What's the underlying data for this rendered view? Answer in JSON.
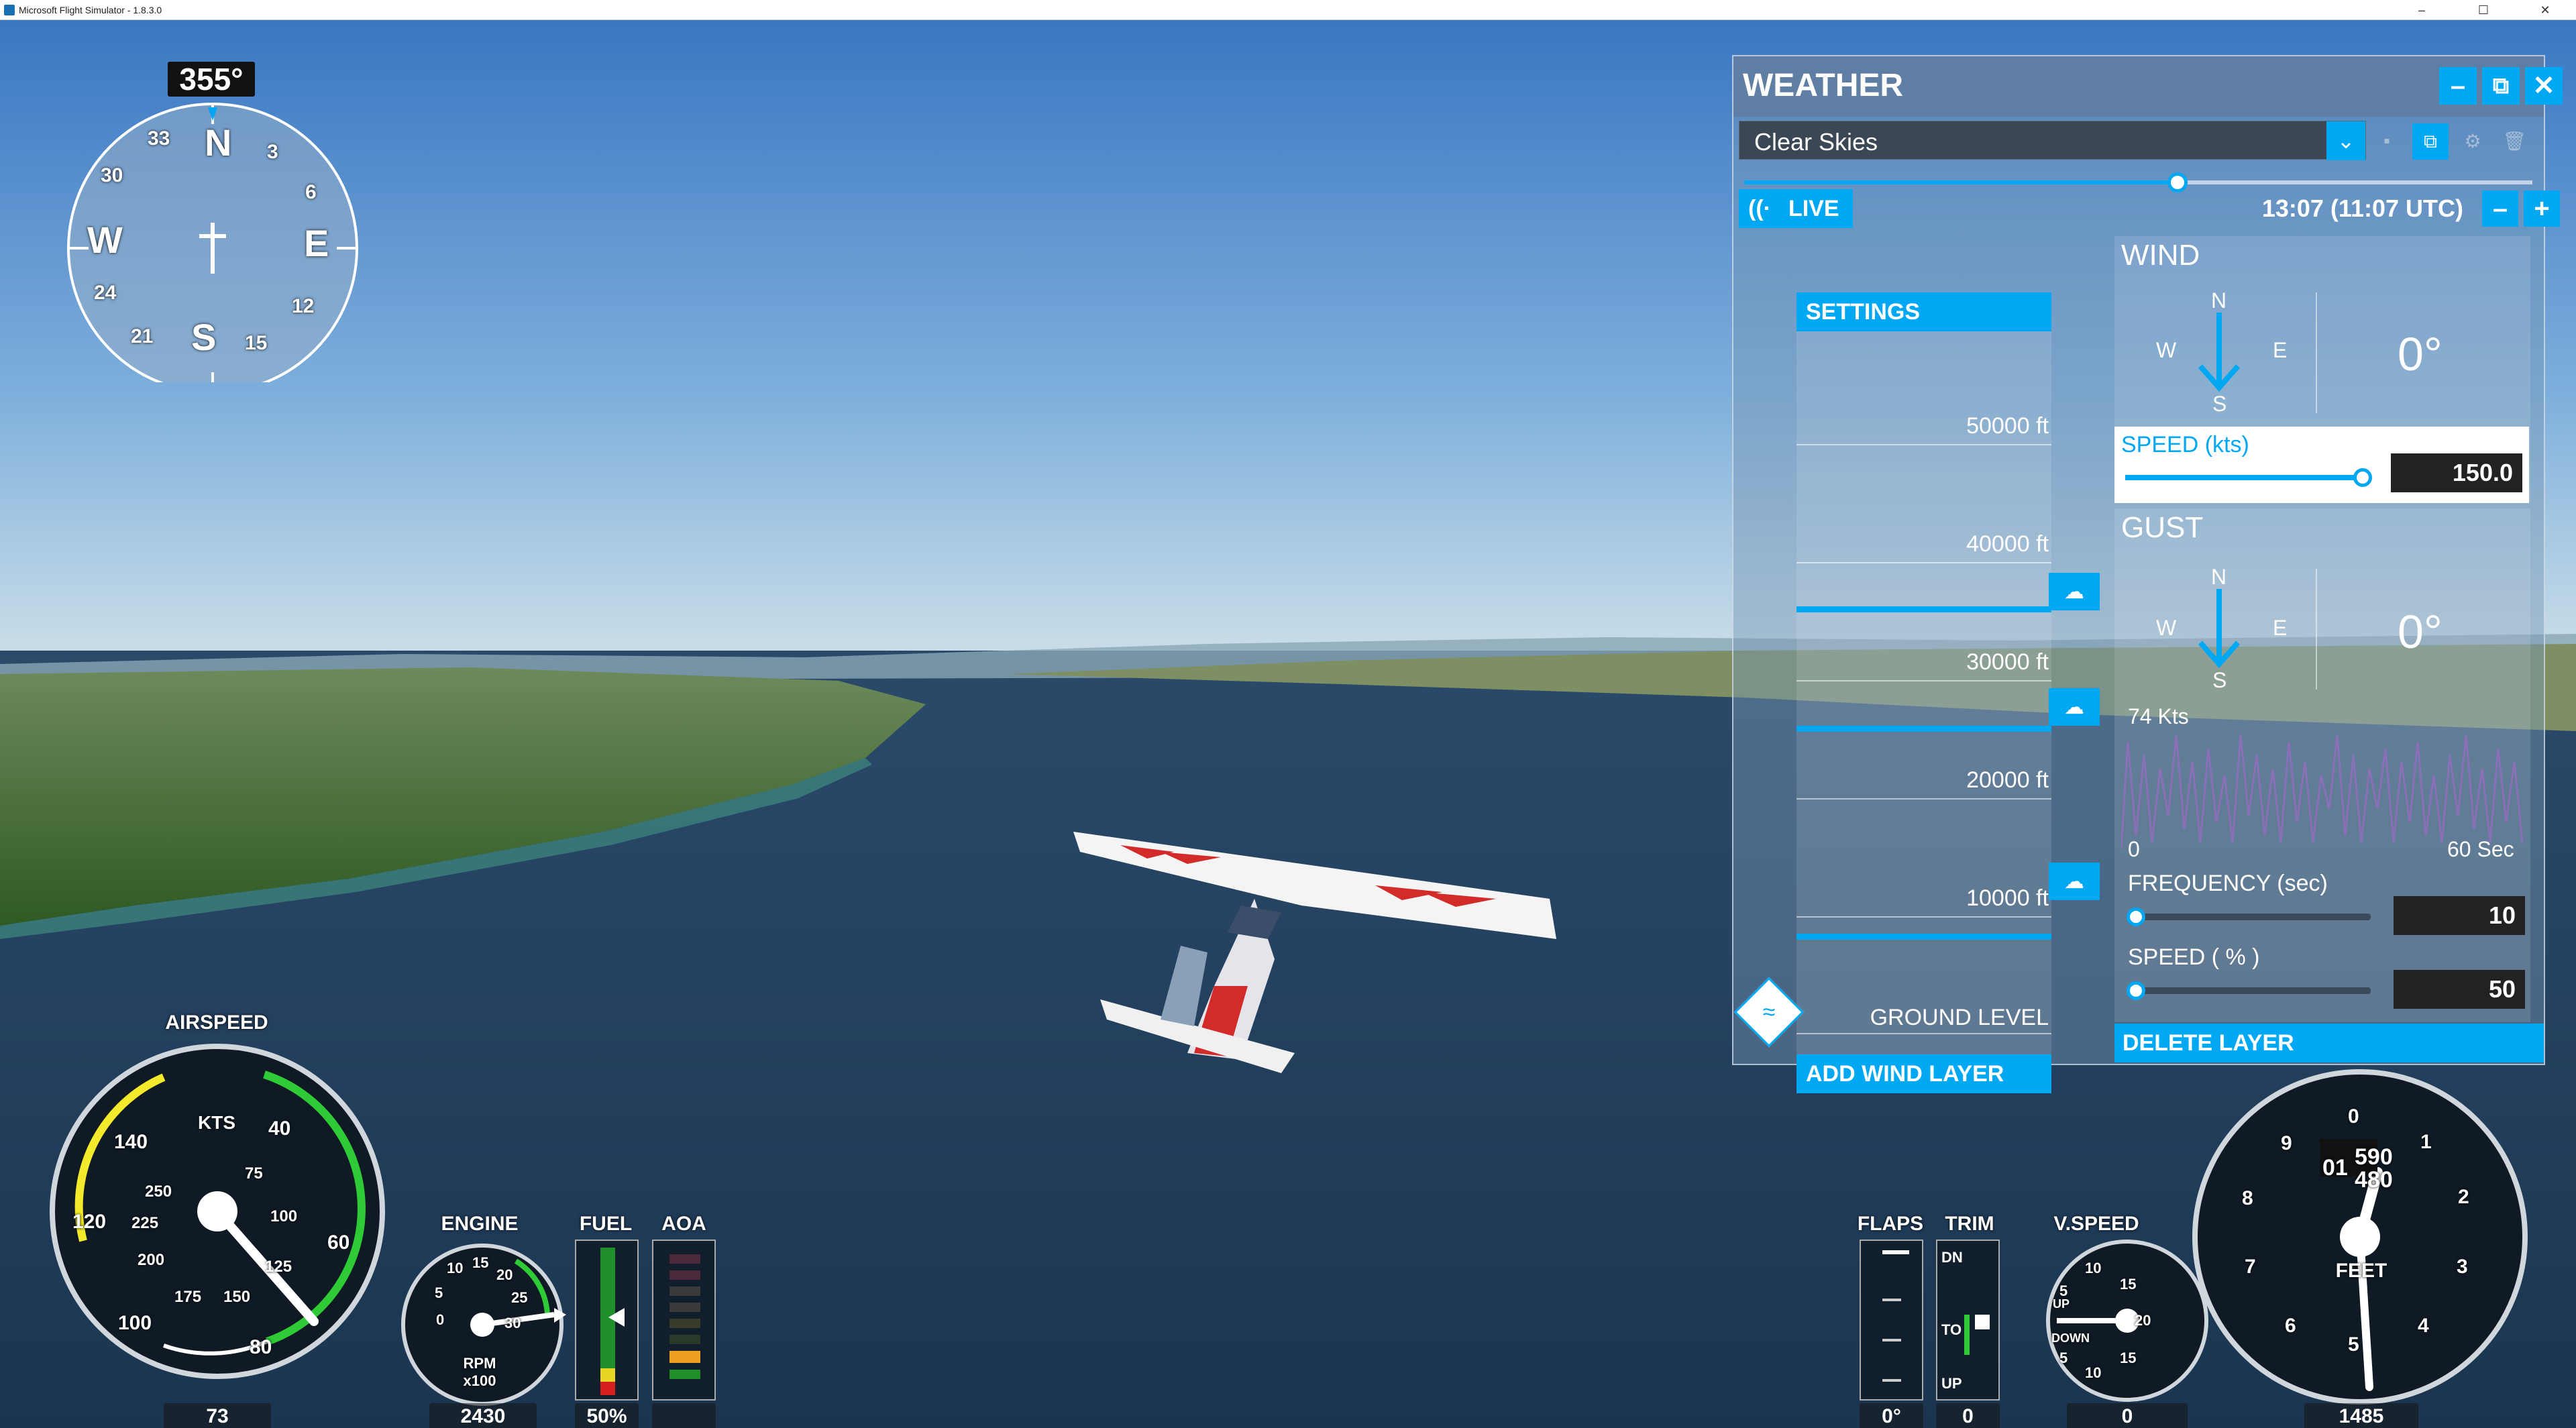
{
  "window": {
    "title": "Microsoft Flight Simulator - 1.8.3.0",
    "controls": [
      "–",
      "☐",
      "✕"
    ]
  },
  "hud": {
    "heading": "355°",
    "compass_letters": {
      "n": "N",
      "e": "E",
      "s": "S",
      "w": "W"
    },
    "compass_numbers": [
      "3",
      "6",
      "12",
      "15",
      "21",
      "24",
      "30",
      "33"
    ],
    "airspeed": {
      "label": "AIRSPEED",
      "units": "KTS",
      "value": "73",
      "ticks": [
        "40",
        "60",
        "80",
        "100",
        "120",
        "140",
        "75",
        "100",
        "125",
        "150",
        "175",
        "200",
        "225",
        "250"
      ]
    },
    "engine": {
      "label": "ENGINE",
      "units": "RPM x100",
      "value": "2430",
      "ticks": [
        "0",
        "5",
        "10",
        "15",
        "20",
        "25",
        "30"
      ]
    },
    "fuel": {
      "label": "FUEL",
      "value": "50%"
    },
    "aoa": {
      "label": "AOA",
      "value": ""
    },
    "flaps": {
      "label": "FLAPS",
      "value": "0°"
    },
    "trim": {
      "label": "TRIM",
      "value": "0",
      "marks": [
        "DN",
        "TO",
        "UP"
      ]
    },
    "vspeed": {
      "label": "V.SPEED",
      "value": "0",
      "ticks": [
        "5",
        "10",
        "15",
        "20",
        "15",
        "10",
        "5"
      ],
      "up": "UP",
      "down": "DOWN"
    },
    "altimeter": {
      "value": "1485",
      "units": "FEET",
      "digits_main": "01",
      "digits_roll_top": "590",
      "digits_roll_bot": "480",
      "ticks": [
        "0",
        "1",
        "2",
        "3",
        "4",
        "5",
        "6",
        "7",
        "8",
        "9"
      ]
    }
  },
  "weather": {
    "title": "WEATHER",
    "header_buttons": [
      "–",
      "⧉",
      "✕"
    ],
    "preset": "Clear Skies",
    "time": {
      "text": "13:07 (11:07 UTC)",
      "live_label": "LIVE",
      "slider_fraction": 0.55
    },
    "altitude_column": {
      "settings_tab": "SETTINGS",
      "labels": [
        "50000 ft",
        "40000 ft",
        "30000 ft",
        "20000 ft",
        "10000 ft",
        "GROUND LEVEL"
      ],
      "add_wind_layer": "ADD WIND LAYER"
    },
    "wind": {
      "title": "WIND",
      "n": "N",
      "s": "S",
      "e": "E",
      "w": "W",
      "direction": "0°",
      "speed_label": "SPEED (kts)",
      "speed_value": "150.0",
      "speed_fraction": 1.0
    },
    "gust": {
      "title": "GUST",
      "n": "N",
      "s": "S",
      "e": "E",
      "w": "W",
      "direction": "0°",
      "graph_max": "74 Kts",
      "graph_min": "0",
      "graph_span": "60 Sec",
      "frequency_label": "FREQUENCY (sec)",
      "frequency_value": "10",
      "speed_label": "SPEED ( % )",
      "speed_value": "50"
    },
    "delete_layer": "DELETE LAYER"
  },
  "colors": {
    "accent": "#00a8f3",
    "sky_top": "#3e7cc4",
    "sky_horizon": "#c8dde8",
    "water": "#1d3a58"
  }
}
